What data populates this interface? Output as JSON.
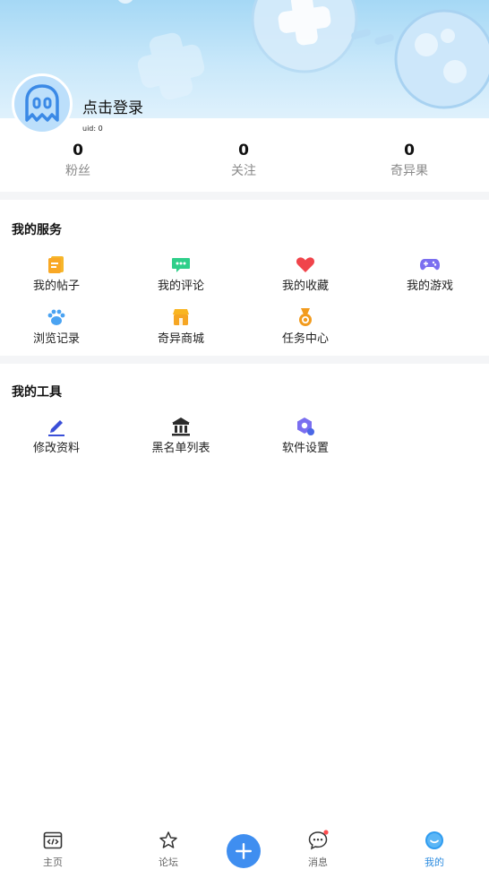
{
  "profile": {
    "login_label": "点击登录",
    "uid_label": "uid: 0"
  },
  "stats": [
    {
      "value": "0",
      "label": "粉丝"
    },
    {
      "value": "0",
      "label": "关注"
    },
    {
      "value": "0",
      "label": "奇异果"
    }
  ],
  "services": {
    "title": "我的服务",
    "items": [
      {
        "label": "我的帖子",
        "icon": "document-icon"
      },
      {
        "label": "我的评论",
        "icon": "comment-icon"
      },
      {
        "label": "我的收藏",
        "icon": "heart-icon"
      },
      {
        "label": "我的游戏",
        "icon": "gamepad-icon"
      },
      {
        "label": "浏览记录",
        "icon": "paw-icon"
      },
      {
        "label": "奇异商城",
        "icon": "store-icon"
      },
      {
        "label": "任务中心",
        "icon": "medal-icon"
      }
    ]
  },
  "tools": {
    "title": "我的工具",
    "items": [
      {
        "label": "修改资料",
        "icon": "edit-icon"
      },
      {
        "label": "黑名单列表",
        "icon": "blacklist-icon"
      },
      {
        "label": "软件设置",
        "icon": "settings-icon"
      }
    ]
  },
  "tabbar": {
    "items": [
      {
        "label": "主页",
        "icon": "code-window-icon"
      },
      {
        "label": "论坛",
        "icon": "star-icon"
      },
      {
        "label": "消息",
        "icon": "chat-bubble-icon"
      },
      {
        "label": "我的",
        "icon": "profile-face-icon",
        "active": true
      }
    ],
    "plus_icon": "plus-icon"
  },
  "colors": {
    "accent": "#3f8ef0",
    "active_tab": "#2f8de0",
    "header_bg": "#c9e8fa",
    "divider": "#f4f5f7",
    "badge": "#ff4d4f"
  }
}
